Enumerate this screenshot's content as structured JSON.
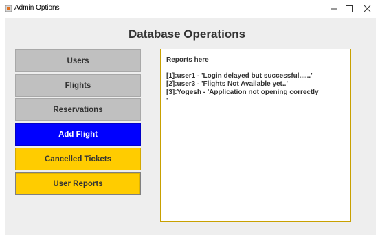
{
  "window": {
    "title": "Admin Options"
  },
  "heading": "Database Operations",
  "menu": [
    {
      "label": "Users",
      "style": "gray"
    },
    {
      "label": "Flights",
      "style": "gray"
    },
    {
      "label": "Reservations",
      "style": "gray"
    },
    {
      "label": "Add Flight",
      "style": "blue"
    },
    {
      "label": "Cancelled Tickets",
      "style": "yellow"
    },
    {
      "label": "User Reports",
      "style": "yellow-selected"
    }
  ],
  "reports": {
    "title": "Reports here",
    "lines": [
      "[1]:user1 - 'Login delayed but successful......'",
      "[2]:user3 - 'Flights Not Available yet..'",
      "[3]:Yogesh - 'Application not opening correctly",
      "'"
    ]
  },
  "colors": {
    "gray_button": "#c0c0c0",
    "blue_button": "#0000ff",
    "yellow_button": "#ffcc00",
    "panel_border": "#c8a000",
    "background": "#eeeeee"
  },
  "icons": {
    "app": "java-app-icon",
    "minimize": "minimize-icon",
    "maximize": "maximize-icon",
    "close": "close-icon"
  }
}
